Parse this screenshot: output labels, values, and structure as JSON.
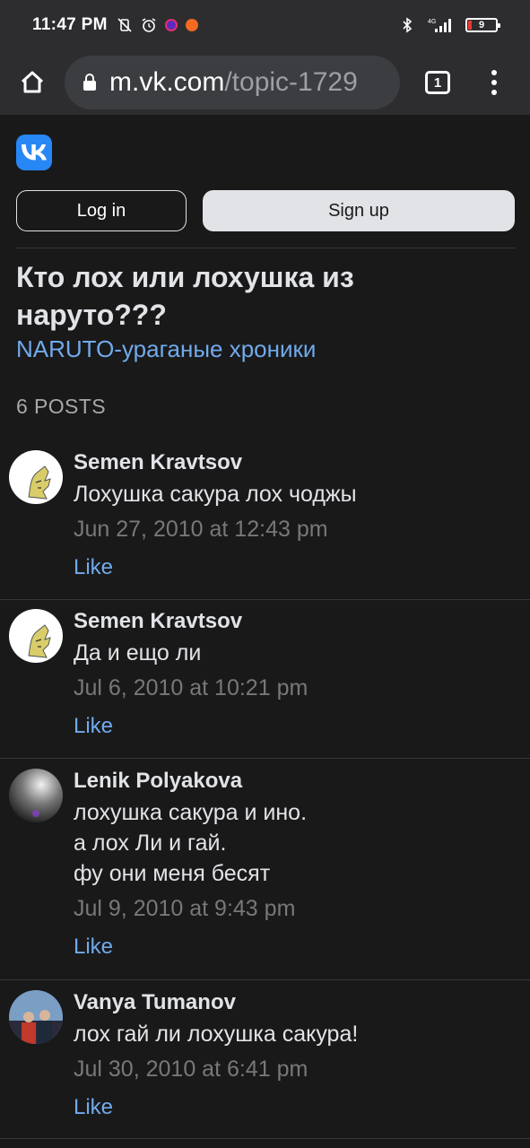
{
  "status_bar": {
    "time": "11:47 PM",
    "battery": "9",
    "network": "4G"
  },
  "browser": {
    "url_host": "m.vk.com",
    "url_path": "/topic-1729",
    "tab_count": "1"
  },
  "auth": {
    "login_label": "Log in",
    "signup_label": "Sign up"
  },
  "topic": {
    "title": "Кто лох или лохушка из наруто???",
    "group": "NARUTO-ураганые хроники",
    "posts_count": "6 POSTS"
  },
  "posts": [
    {
      "author": "Semen Kravtsov",
      "text": "Лохушка сакура лох чоджы",
      "date": "Jun 27, 2010 at 12:43 pm",
      "like": "Like"
    },
    {
      "author": "Semen Kravtsov",
      "text": "Да и ещо ли",
      "date": "Jul 6, 2010 at 10:21 pm",
      "like": "Like"
    },
    {
      "author": "Lenik Polyakova",
      "text": "лохушка сакура и ино.\nа лох Ли и гай.\nфу они меня бесят",
      "date": "Jul 9, 2010 at 9:43 pm",
      "like": "Like"
    },
    {
      "author": "Vanya Tumanov",
      "text": "лох гай ли лохушка сакура!",
      "date": "Jul 30, 2010 at 6:41 pm",
      "like": "Like"
    }
  ],
  "colors": {
    "background": "#19191a",
    "link": "#71aaeb",
    "vk_blue": "#2787f5",
    "bar": "#2d2d30"
  }
}
